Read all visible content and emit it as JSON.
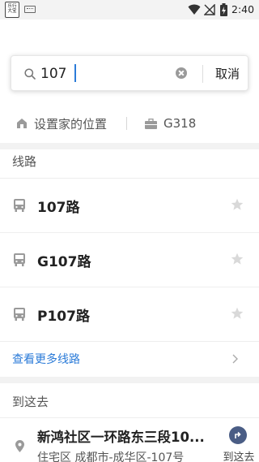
{
  "status_bar": {
    "app_icon_text": "乐行\n大宝",
    "time": "2:40"
  },
  "search": {
    "value": "107",
    "placeholder": "",
    "cancel_label": "取消"
  },
  "shortcuts": {
    "home_label": "设置家的位置",
    "work_label": "G318"
  },
  "routes_section": {
    "title": "线路",
    "items": [
      {
        "name": "107路"
      },
      {
        "name": "G107路"
      },
      {
        "name": "P107路"
      }
    ],
    "more_label": "查看更多线路"
  },
  "destination_section": {
    "title": "到这去",
    "items": [
      {
        "title": "新鸿社区一环路东三段10...",
        "subtitle": "住宅区 成都市-成华区-107号",
        "action_label": "到这去"
      }
    ]
  },
  "colors": {
    "accent": "#2b7bd8",
    "go_button": "#4a5d85",
    "divider": "#f2f2f2"
  }
}
